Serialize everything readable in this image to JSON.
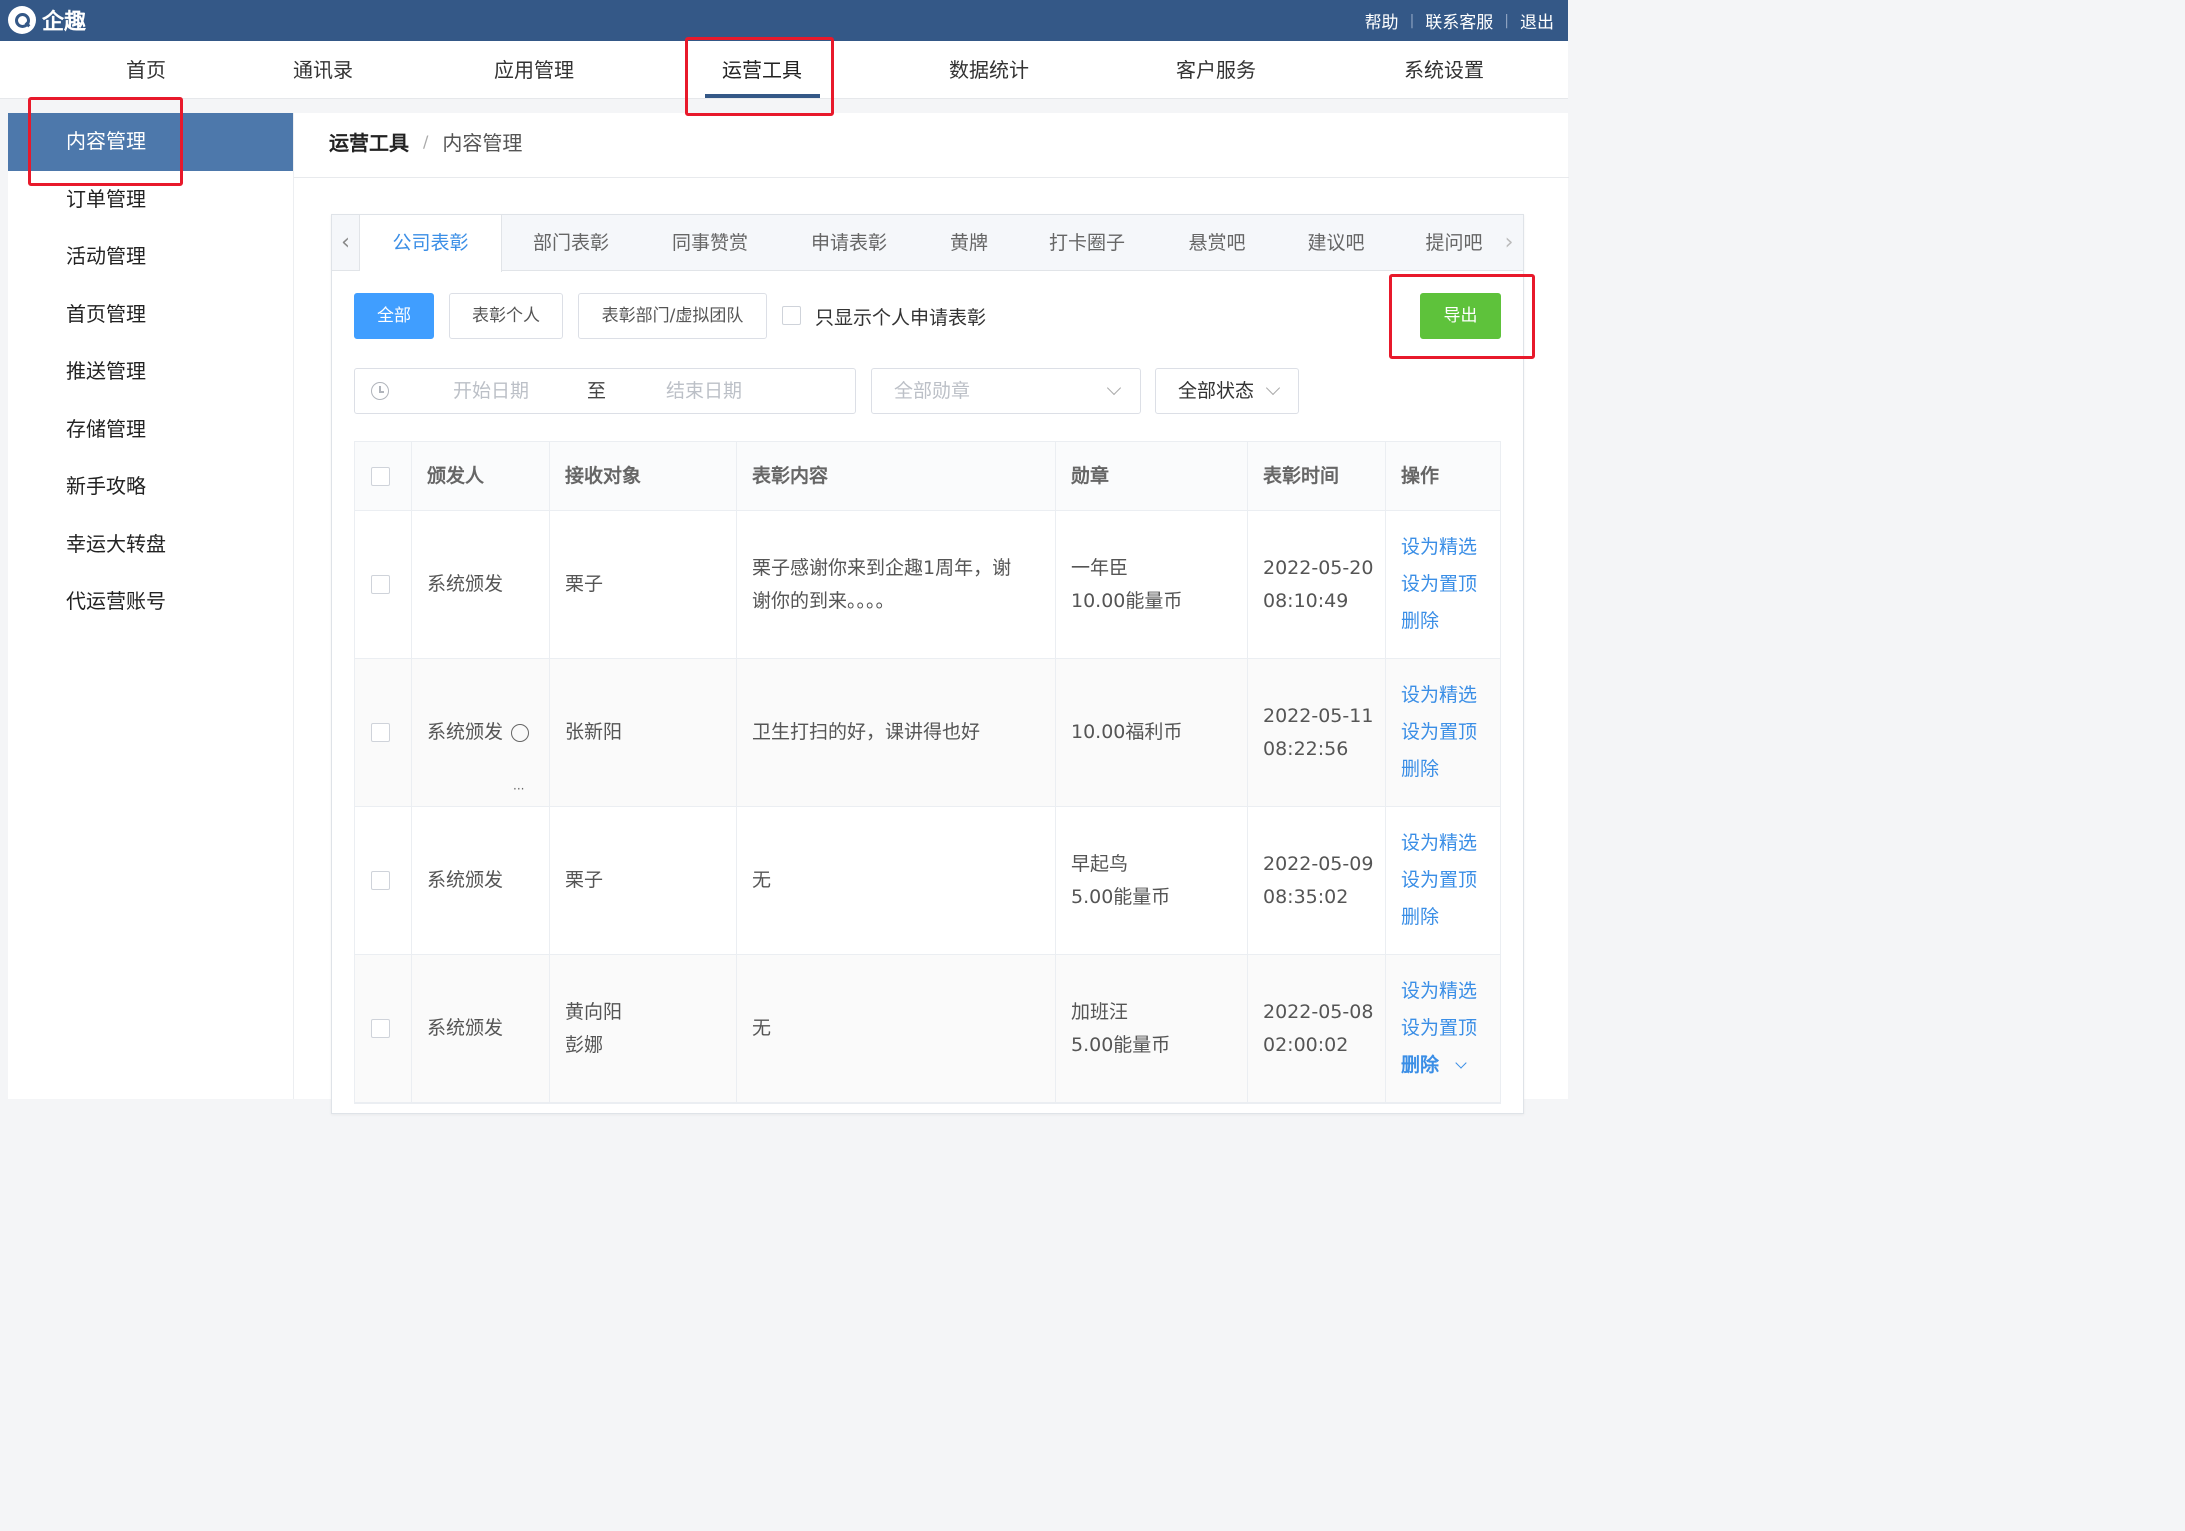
{
  "app": {
    "name": "企趣"
  },
  "toplinks": [
    "帮助",
    "联系客服",
    "退出"
  ],
  "mainnav": [
    "首页",
    "通讯录",
    "应用管理",
    "运营工具",
    "数据统计",
    "客户服务",
    "系统设置"
  ],
  "sidebar": [
    "内容管理",
    "订单管理",
    "活动管理",
    "首页管理",
    "推送管理",
    "存储管理",
    "新手攻略",
    "幸运大转盘",
    "代运营账号"
  ],
  "breadcrumb": {
    "parent": "运营工具",
    "sep": "/",
    "current": "内容管理"
  },
  "tabs": [
    "公司表彰",
    "部门表彰",
    "同事赞赏",
    "申请表彰",
    "黄牌",
    "打卡圈子",
    "悬赏吧",
    "建议吧",
    "提问吧"
  ],
  "filters": {
    "all": "全部",
    "personal": "表彰个人",
    "dept": "表彰部门/虚拟团队",
    "only_personal": "只显示个人申请表彰",
    "export": "导出",
    "start_placeholder": "开始日期",
    "to": "至",
    "end_placeholder": "结束日期",
    "medal_placeholder": "全部勋章",
    "status": "全部状态"
  },
  "table": {
    "headers": [
      "颁发人",
      "接收对象",
      "表彰内容",
      "勋章",
      "表彰时间",
      "操作"
    ],
    "rows": [
      {
        "issuer": "系统颁发",
        "receivers": [
          "栗子"
        ],
        "content": [
          "栗子感谢你来到企趣1周年，谢",
          "谢你的到来。。。。"
        ],
        "medal": [
          "一年臣",
          "10.00能量币"
        ],
        "time": [
          "2022-05-20",
          "08:10:49"
        ]
      },
      {
        "issuer": "系统颁发",
        "receivers": [
          "张新阳"
        ],
        "content": [
          "卫生打扫的好，课讲得也好"
        ],
        "medal": [
          "10.00福利币"
        ],
        "time": [
          "2022-05-11",
          "08:22:56"
        ]
      },
      {
        "issuer": "系统颁发",
        "receivers": [
          "栗子"
        ],
        "content": [
          "无"
        ],
        "medal": [
          "早起鸟",
          "5.00能量币"
        ],
        "time": [
          "2022-05-09",
          "08:35:02"
        ]
      },
      {
        "issuer": "系统颁发",
        "receivers": [
          "黄向阳",
          "彭娜"
        ],
        "content": [
          "无"
        ],
        "medal": [
          "加班汪",
          "5.00能量币"
        ],
        "time": [
          "2022-05-08",
          "02:00:02"
        ]
      }
    ],
    "actions": [
      "设为精选",
      "设为置顶",
      "删除"
    ]
  },
  "colors": {
    "topbar": "#345887",
    "primary": "#409eff",
    "success": "#5ec23b",
    "highlight": "#e8192b",
    "sidebar_active": "#4d78ab"
  }
}
